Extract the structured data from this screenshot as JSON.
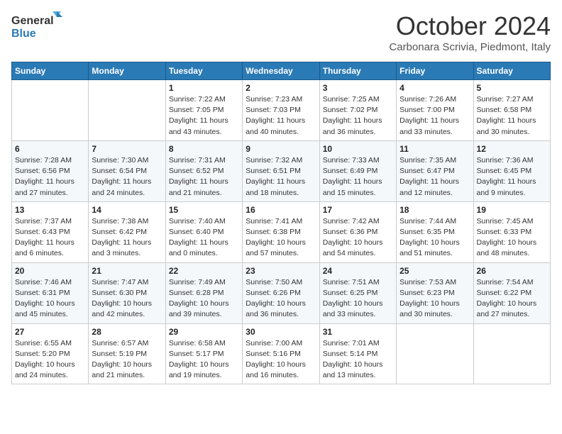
{
  "logo": {
    "text_general": "General",
    "text_blue": "Blue"
  },
  "title": "October 2024",
  "subtitle": "Carbonara Scrivia, Piedmont, Italy",
  "days_of_week": [
    "Sunday",
    "Monday",
    "Tuesday",
    "Wednesday",
    "Thursday",
    "Friday",
    "Saturday"
  ],
  "weeks": [
    [
      {
        "day": "",
        "sunrise": "",
        "sunset": "",
        "daylight": ""
      },
      {
        "day": "",
        "sunrise": "",
        "sunset": "",
        "daylight": ""
      },
      {
        "day": "1",
        "sunrise": "Sunrise: 7:22 AM",
        "sunset": "Sunset: 7:05 PM",
        "daylight": "Daylight: 11 hours and 43 minutes."
      },
      {
        "day": "2",
        "sunrise": "Sunrise: 7:23 AM",
        "sunset": "Sunset: 7:03 PM",
        "daylight": "Daylight: 11 hours and 40 minutes."
      },
      {
        "day": "3",
        "sunrise": "Sunrise: 7:25 AM",
        "sunset": "Sunset: 7:02 PM",
        "daylight": "Daylight: 11 hours and 36 minutes."
      },
      {
        "day": "4",
        "sunrise": "Sunrise: 7:26 AM",
        "sunset": "Sunset: 7:00 PM",
        "daylight": "Daylight: 11 hours and 33 minutes."
      },
      {
        "day": "5",
        "sunrise": "Sunrise: 7:27 AM",
        "sunset": "Sunset: 6:58 PM",
        "daylight": "Daylight: 11 hours and 30 minutes."
      }
    ],
    [
      {
        "day": "6",
        "sunrise": "Sunrise: 7:28 AM",
        "sunset": "Sunset: 6:56 PM",
        "daylight": "Daylight: 11 hours and 27 minutes."
      },
      {
        "day": "7",
        "sunrise": "Sunrise: 7:30 AM",
        "sunset": "Sunset: 6:54 PM",
        "daylight": "Daylight: 11 hours and 24 minutes."
      },
      {
        "day": "8",
        "sunrise": "Sunrise: 7:31 AM",
        "sunset": "Sunset: 6:52 PM",
        "daylight": "Daylight: 11 hours and 21 minutes."
      },
      {
        "day": "9",
        "sunrise": "Sunrise: 7:32 AM",
        "sunset": "Sunset: 6:51 PM",
        "daylight": "Daylight: 11 hours and 18 minutes."
      },
      {
        "day": "10",
        "sunrise": "Sunrise: 7:33 AM",
        "sunset": "Sunset: 6:49 PM",
        "daylight": "Daylight: 11 hours and 15 minutes."
      },
      {
        "day": "11",
        "sunrise": "Sunrise: 7:35 AM",
        "sunset": "Sunset: 6:47 PM",
        "daylight": "Daylight: 11 hours and 12 minutes."
      },
      {
        "day": "12",
        "sunrise": "Sunrise: 7:36 AM",
        "sunset": "Sunset: 6:45 PM",
        "daylight": "Daylight: 11 hours and 9 minutes."
      }
    ],
    [
      {
        "day": "13",
        "sunrise": "Sunrise: 7:37 AM",
        "sunset": "Sunset: 6:43 PM",
        "daylight": "Daylight: 11 hours and 6 minutes."
      },
      {
        "day": "14",
        "sunrise": "Sunrise: 7:38 AM",
        "sunset": "Sunset: 6:42 PM",
        "daylight": "Daylight: 11 hours and 3 minutes."
      },
      {
        "day": "15",
        "sunrise": "Sunrise: 7:40 AM",
        "sunset": "Sunset: 6:40 PM",
        "daylight": "Daylight: 11 hours and 0 minutes."
      },
      {
        "day": "16",
        "sunrise": "Sunrise: 7:41 AM",
        "sunset": "Sunset: 6:38 PM",
        "daylight": "Daylight: 10 hours and 57 minutes."
      },
      {
        "day": "17",
        "sunrise": "Sunrise: 7:42 AM",
        "sunset": "Sunset: 6:36 PM",
        "daylight": "Daylight: 10 hours and 54 minutes."
      },
      {
        "day": "18",
        "sunrise": "Sunrise: 7:44 AM",
        "sunset": "Sunset: 6:35 PM",
        "daylight": "Daylight: 10 hours and 51 minutes."
      },
      {
        "day": "19",
        "sunrise": "Sunrise: 7:45 AM",
        "sunset": "Sunset: 6:33 PM",
        "daylight": "Daylight: 10 hours and 48 minutes."
      }
    ],
    [
      {
        "day": "20",
        "sunrise": "Sunrise: 7:46 AM",
        "sunset": "Sunset: 6:31 PM",
        "daylight": "Daylight: 10 hours and 45 minutes."
      },
      {
        "day": "21",
        "sunrise": "Sunrise: 7:47 AM",
        "sunset": "Sunset: 6:30 PM",
        "daylight": "Daylight: 10 hours and 42 minutes."
      },
      {
        "day": "22",
        "sunrise": "Sunrise: 7:49 AM",
        "sunset": "Sunset: 6:28 PM",
        "daylight": "Daylight: 10 hours and 39 minutes."
      },
      {
        "day": "23",
        "sunrise": "Sunrise: 7:50 AM",
        "sunset": "Sunset: 6:26 PM",
        "daylight": "Daylight: 10 hours and 36 minutes."
      },
      {
        "day": "24",
        "sunrise": "Sunrise: 7:51 AM",
        "sunset": "Sunset: 6:25 PM",
        "daylight": "Daylight: 10 hours and 33 minutes."
      },
      {
        "day": "25",
        "sunrise": "Sunrise: 7:53 AM",
        "sunset": "Sunset: 6:23 PM",
        "daylight": "Daylight: 10 hours and 30 minutes."
      },
      {
        "day": "26",
        "sunrise": "Sunrise: 7:54 AM",
        "sunset": "Sunset: 6:22 PM",
        "daylight": "Daylight: 10 hours and 27 minutes."
      }
    ],
    [
      {
        "day": "27",
        "sunrise": "Sunrise: 6:55 AM",
        "sunset": "Sunset: 5:20 PM",
        "daylight": "Daylight: 10 hours and 24 minutes."
      },
      {
        "day": "28",
        "sunrise": "Sunrise: 6:57 AM",
        "sunset": "Sunset: 5:19 PM",
        "daylight": "Daylight: 10 hours and 21 minutes."
      },
      {
        "day": "29",
        "sunrise": "Sunrise: 6:58 AM",
        "sunset": "Sunset: 5:17 PM",
        "daylight": "Daylight: 10 hours and 19 minutes."
      },
      {
        "day": "30",
        "sunrise": "Sunrise: 7:00 AM",
        "sunset": "Sunset: 5:16 PM",
        "daylight": "Daylight: 10 hours and 16 minutes."
      },
      {
        "day": "31",
        "sunrise": "Sunrise: 7:01 AM",
        "sunset": "Sunset: 5:14 PM",
        "daylight": "Daylight: 10 hours and 13 minutes."
      },
      {
        "day": "",
        "sunrise": "",
        "sunset": "",
        "daylight": ""
      },
      {
        "day": "",
        "sunrise": "",
        "sunset": "",
        "daylight": ""
      }
    ]
  ]
}
